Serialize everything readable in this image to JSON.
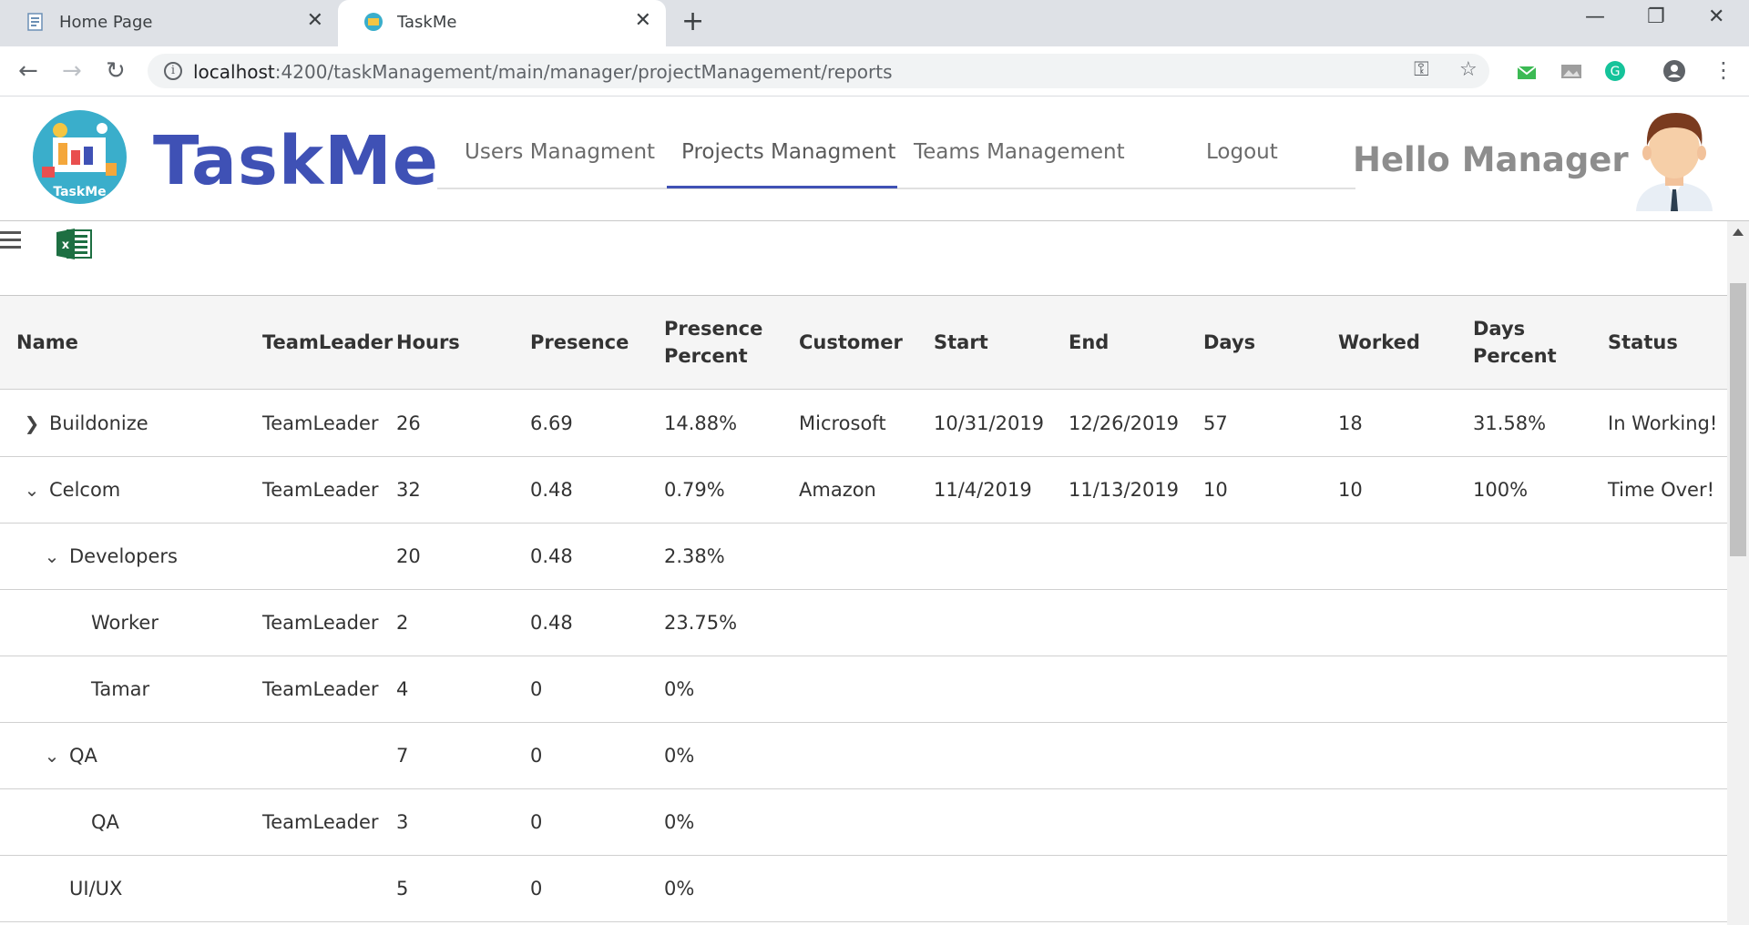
{
  "browser": {
    "tabs": [
      {
        "title": "Home Page",
        "active": false
      },
      {
        "title": "TaskMe",
        "active": true
      }
    ],
    "url_host": "localhost",
    "url_rest": ":4200/taskManagement/main/manager/projectManagement/reports"
  },
  "header": {
    "logo_text": "TaskMe",
    "brand": "TaskMe",
    "nav": {
      "users": "Users Managment",
      "projects": "Projects Managment",
      "teams": "Teams Management",
      "logout": "Logout"
    },
    "greeting": "Hello Manager"
  },
  "table": {
    "columns": {
      "name": "Name",
      "teamleader": "TeamLeader",
      "hours": "Hours",
      "presence": "Presence",
      "presence_percent": "Presence Percent",
      "customer": "Customer",
      "start": "Start",
      "end": "End",
      "days": "Days",
      "worked": "Worked",
      "days_percent": "Days Percent",
      "status": "Status"
    },
    "rows": [
      {
        "name": "Buildonize",
        "expand": "collapsed",
        "teamleader": "TeamLeader",
        "hours": "26",
        "presence": "6.69",
        "presence_percent": "14.88%",
        "customer": "Microsoft",
        "start": "10/31/2019",
        "end": "12/26/2019",
        "days": "57",
        "worked": "18",
        "days_percent": "31.58%",
        "status": "In Working!"
      },
      {
        "name": "Celcom",
        "expand": "expanded",
        "teamleader": "TeamLeader",
        "hours": "32",
        "presence": "0.48",
        "presence_percent": "0.79%",
        "customer": "Amazon",
        "start": "11/4/2019",
        "end": "11/13/2019",
        "days": "10",
        "worked": "10",
        "days_percent": "100%",
        "status": "Time Over!"
      },
      {
        "name": "Developers",
        "expand": "expanded",
        "teamleader": "",
        "hours": "20",
        "presence": "0.48",
        "presence_percent": "2.38%",
        "customer": "",
        "start": "",
        "end": "",
        "days": "",
        "worked": "",
        "days_percent": "",
        "status": ""
      },
      {
        "name": "Worker",
        "expand": "none",
        "teamleader": "TeamLeader",
        "hours": "2",
        "presence": "0.48",
        "presence_percent": "23.75%",
        "customer": "",
        "start": "",
        "end": "",
        "days": "",
        "worked": "",
        "days_percent": "",
        "status": ""
      },
      {
        "name": "Tamar",
        "expand": "none",
        "teamleader": "TeamLeader",
        "hours": "4",
        "presence": "0",
        "presence_percent": "0%",
        "customer": "",
        "start": "",
        "end": "",
        "days": "",
        "worked": "",
        "days_percent": "",
        "status": ""
      },
      {
        "name": "QA",
        "expand": "expanded",
        "teamleader": "",
        "hours": "7",
        "presence": "0",
        "presence_percent": "0%",
        "customer": "",
        "start": "",
        "end": "",
        "days": "",
        "worked": "",
        "days_percent": "",
        "status": ""
      },
      {
        "name": "QA",
        "expand": "none",
        "teamleader": "TeamLeader",
        "hours": "3",
        "presence": "0",
        "presence_percent": "0%",
        "customer": "",
        "start": "",
        "end": "",
        "days": "",
        "worked": "",
        "days_percent": "",
        "status": ""
      },
      {
        "name": "UI/UX",
        "expand": "none",
        "teamleader": "",
        "hours": "5",
        "presence": "0",
        "presence_percent": "0%",
        "customer": "",
        "start": "",
        "end": "",
        "days": "",
        "worked": "",
        "days_percent": "",
        "status": ""
      }
    ]
  },
  "colors": {
    "brand": "#3f51b5",
    "nav_ink": "#3f51b5",
    "header_bg": "#f5f5f5",
    "logo_bg": "#3aaecb",
    "excel_green": "#1d6f42"
  },
  "icons": {
    "menu": "hamburger-menu-icon",
    "export": "excel-icon",
    "collapsed": "chevron-right-icon",
    "expanded": "chevron-down-icon"
  }
}
